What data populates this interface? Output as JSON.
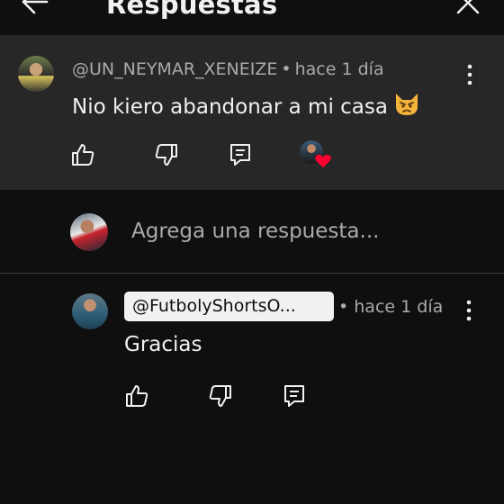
{
  "header": {
    "title": "Respuestas",
    "back_icon": "arrow-left-icon",
    "close_icon": "close-icon"
  },
  "main_comment": {
    "author": "@UN_NEYMAR_XENEIZE",
    "separator": "•",
    "time": "hace 1 día",
    "text": "Nio kiero abandonar a mi casa",
    "emoji": "pouting-cat-emoji",
    "actions": [
      "like-icon",
      "dislike-icon",
      "reply-icon"
    ],
    "creator_heart": "heart-icon"
  },
  "add_reply": {
    "placeholder": "Agrega una respuesta..."
  },
  "replies": [
    {
      "author": "@FutbolyShortsO...",
      "separator": "•",
      "time": "hace 1 día",
      "text": "Gracias",
      "actions": [
        "like-icon",
        "dislike-icon",
        "reply-icon"
      ]
    }
  ],
  "colors": {
    "background": "#0f0f0f",
    "highlighted_comment_bg": "#272727",
    "primary_text": "#f1f1f1",
    "secondary_text": "#aaaaaa",
    "heart": "#ff0033",
    "author_chip_bg": "#f1f1f1"
  }
}
